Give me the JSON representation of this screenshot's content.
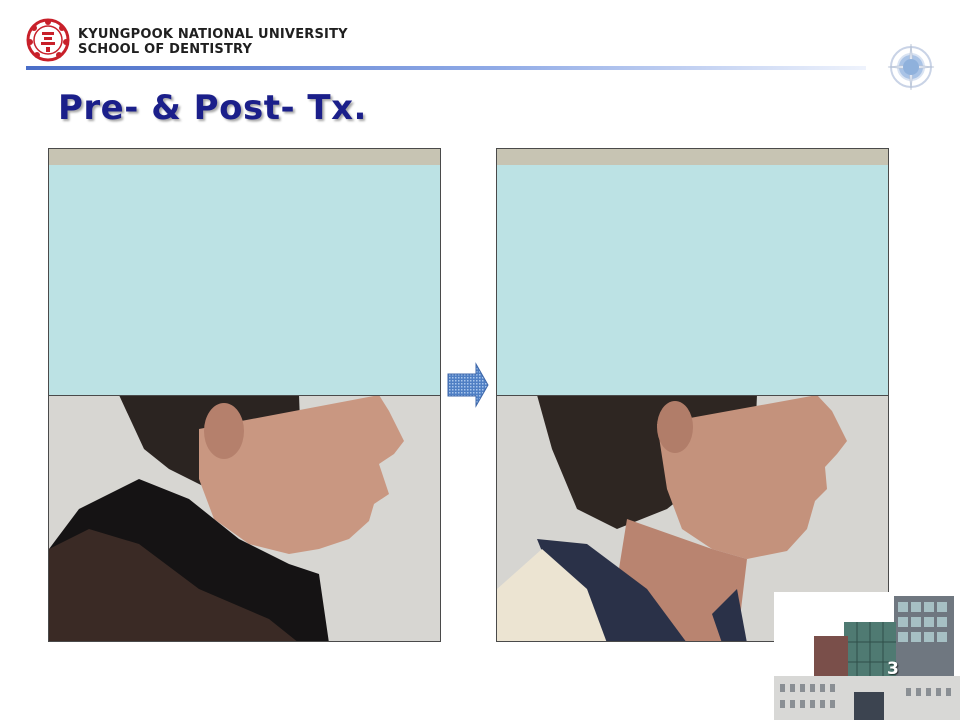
{
  "header": {
    "university_line1": "KYUNGPOOK NATIONAL UNIVERSITY",
    "university_line2": "SCHOOL OF DENTISTRY",
    "logo_icon": "university-seal-icon",
    "compass_icon": "compass-rose-icon",
    "accent_color": "#4a6ec8"
  },
  "slide": {
    "title": "Pre- & Post- Tx.",
    "title_color": "#1b1f8a",
    "page_number": "3"
  },
  "photos": {
    "pre": {
      "content": "profile-photo",
      "mask_color": "#bce2e4"
    },
    "post": {
      "content": "profile-photo",
      "mask_color": "#bce2e4"
    },
    "arrow_icon": "right-arrow-icon"
  },
  "footer": {
    "building_icon": "building-icon"
  }
}
